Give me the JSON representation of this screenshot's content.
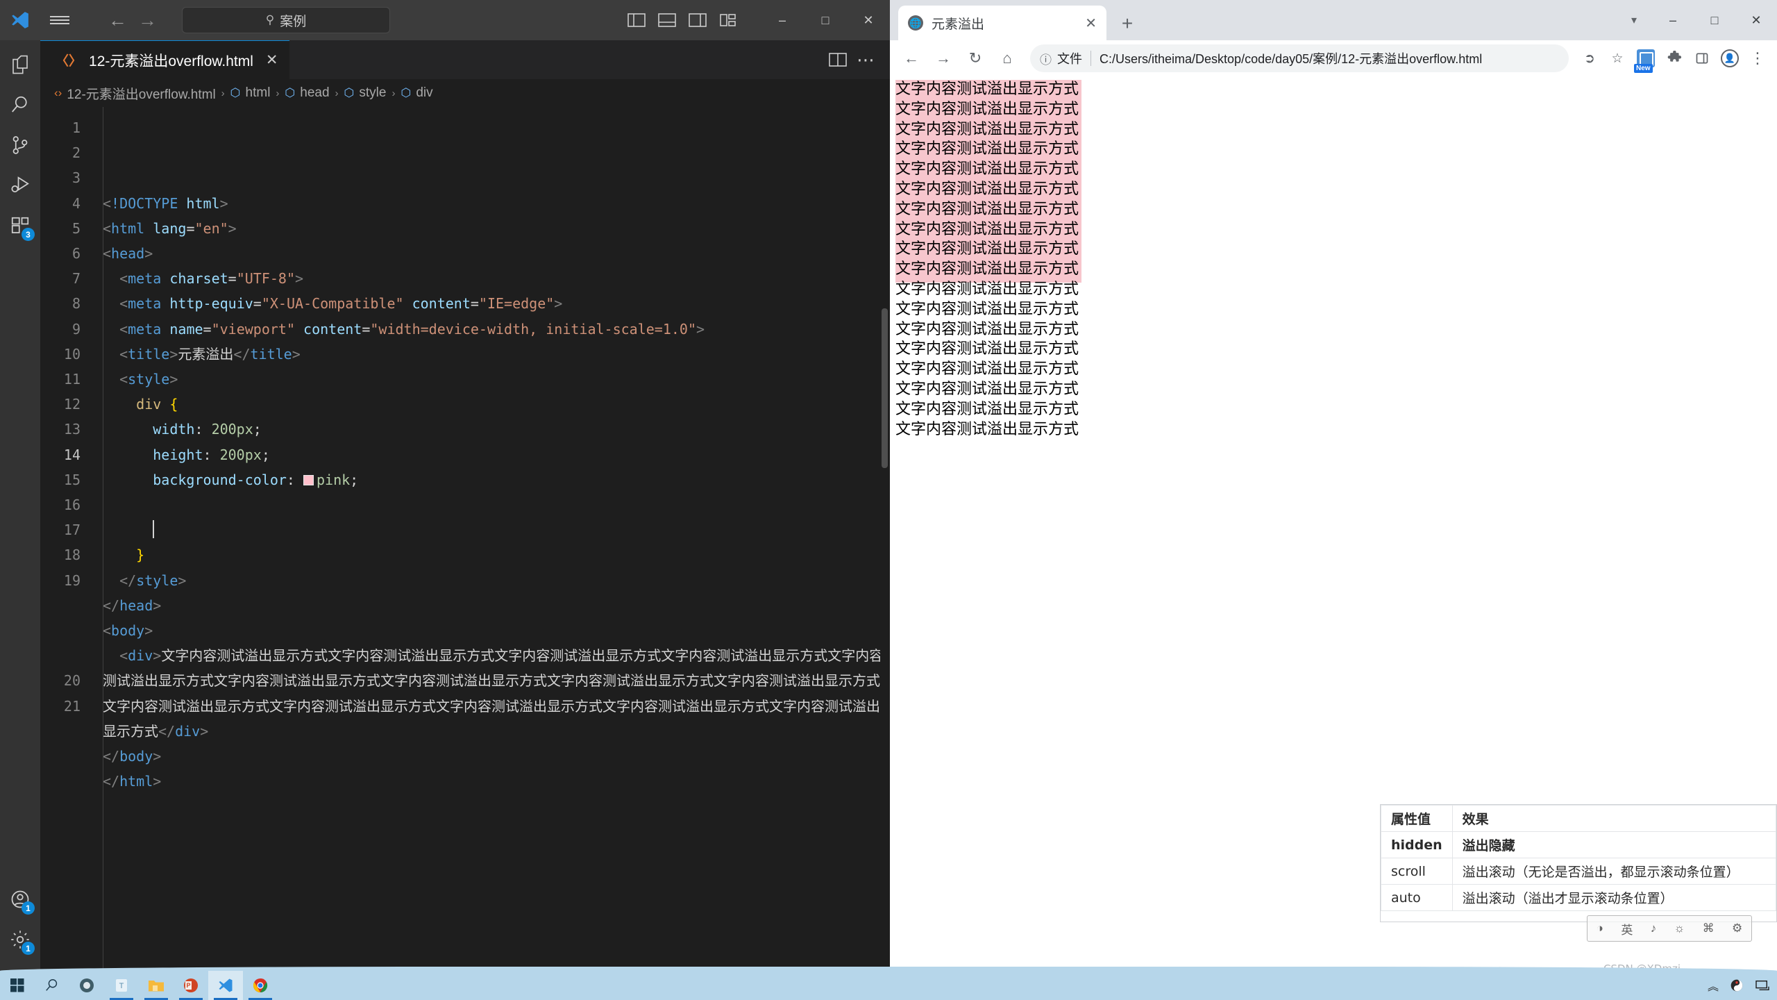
{
  "vscode": {
    "titlebar": {
      "logo_icon": "vscode-logo-icon",
      "menu_icon": "hamburger-menu-icon",
      "back_icon": "back-arrow-icon",
      "forward_icon": "forward-arrow-icon",
      "search_placeholder": "案例",
      "search_icon": "search-icon",
      "layout_icons": [
        "toggle-primary-sidebar-icon",
        "toggle-panel-icon",
        "toggle-secondary-sidebar-icon",
        "customize-layout-icon"
      ],
      "minimize_label": "–",
      "maximize_label": "□",
      "close_label": "✕"
    },
    "activitybar": {
      "items": [
        {
          "name": "explorer",
          "icon": "files-icon",
          "badge": ""
        },
        {
          "name": "search",
          "icon": "search-icon",
          "badge": ""
        },
        {
          "name": "source-control",
          "icon": "source-control-icon",
          "badge": ""
        },
        {
          "name": "run-and-debug",
          "icon": "run-debug-icon",
          "badge": ""
        },
        {
          "name": "extensions",
          "icon": "extensions-icon",
          "badge": "3"
        }
      ],
      "bottom_items": [
        {
          "name": "accounts",
          "icon": "account-icon",
          "badge": "1"
        },
        {
          "name": "settings",
          "icon": "gear-icon",
          "badge": "1"
        }
      ]
    },
    "tab": {
      "icon": "html-file-icon",
      "label": "12-元素溢出overflow.html",
      "close_label": "✕",
      "split_editor_icon": "split-editor-icon",
      "more_actions_icon": "more-actions-icon"
    },
    "breadcrumb": {
      "file_icon": "html-file-icon",
      "items": [
        "12-元素溢出overflow.html",
        "html",
        "head",
        "style",
        "div"
      ],
      "separator": "›",
      "symbol_icon": "symbol-cube-icon",
      "last_icon": "symbol-css-icon"
    },
    "code": {
      "active_line": 14,
      "lines": [
        {
          "n": 1,
          "tokens": [
            {
              "t": "brk",
              "v": "<"
            },
            {
              "t": "tag",
              "v": "!DOCTYPE "
            },
            {
              "t": "attr",
              "v": "html"
            },
            {
              "t": "brk",
              "v": ">"
            }
          ]
        },
        {
          "n": 2,
          "tokens": [
            {
              "t": "brk",
              "v": "<"
            },
            {
              "t": "tag",
              "v": "html "
            },
            {
              "t": "attr",
              "v": "lang"
            },
            {
              "t": "punct",
              "v": "="
            },
            {
              "t": "str",
              "v": "\"en\""
            },
            {
              "t": "brk",
              "v": ">"
            }
          ]
        },
        {
          "n": 3,
          "tokens": [
            {
              "t": "brk",
              "v": "<"
            },
            {
              "t": "tag",
              "v": "head"
            },
            {
              "t": "brk",
              "v": ">"
            }
          ]
        },
        {
          "n": 4,
          "tokens": [
            {
              "t": "txt",
              "v": "  "
            },
            {
              "t": "brk",
              "v": "<"
            },
            {
              "t": "tag",
              "v": "meta "
            },
            {
              "t": "attr",
              "v": "charset"
            },
            {
              "t": "punct",
              "v": "="
            },
            {
              "t": "str",
              "v": "\"UTF-8\""
            },
            {
              "t": "brk",
              "v": ">"
            }
          ]
        },
        {
          "n": 5,
          "tokens": [
            {
              "t": "txt",
              "v": "  "
            },
            {
              "t": "brk",
              "v": "<"
            },
            {
              "t": "tag",
              "v": "meta "
            },
            {
              "t": "attr",
              "v": "http-equiv"
            },
            {
              "t": "punct",
              "v": "="
            },
            {
              "t": "str",
              "v": "\"X-UA-Compatible\""
            },
            {
              "t": "txt",
              "v": " "
            },
            {
              "t": "attr",
              "v": "content"
            },
            {
              "t": "punct",
              "v": "="
            },
            {
              "t": "str",
              "v": "\"IE=edge\""
            },
            {
              "t": "brk",
              "v": ">"
            }
          ]
        },
        {
          "n": 6,
          "tokens": [
            {
              "t": "txt",
              "v": "  "
            },
            {
              "t": "brk",
              "v": "<"
            },
            {
              "t": "tag",
              "v": "meta "
            },
            {
              "t": "attr",
              "v": "name"
            },
            {
              "t": "punct",
              "v": "="
            },
            {
              "t": "str",
              "v": "\"viewport\""
            },
            {
              "t": "txt",
              "v": " "
            },
            {
              "t": "attr",
              "v": "content"
            },
            {
              "t": "punct",
              "v": "="
            },
            {
              "t": "str",
              "v": "\"width=device-width, initial-scale=1.0\""
            },
            {
              "t": "brk",
              "v": ">"
            }
          ]
        },
        {
          "n": 7,
          "tokens": [
            {
              "t": "txt",
              "v": "  "
            },
            {
              "t": "brk",
              "v": "<"
            },
            {
              "t": "tag",
              "v": "title"
            },
            {
              "t": "brk",
              "v": ">"
            },
            {
              "t": "txt",
              "v": "元素溢出"
            },
            {
              "t": "brk",
              "v": "</"
            },
            {
              "t": "tag",
              "v": "title"
            },
            {
              "t": "brk",
              "v": ">"
            }
          ]
        },
        {
          "n": 8,
          "tokens": [
            {
              "t": "txt",
              "v": "  "
            },
            {
              "t": "brk",
              "v": "<"
            },
            {
              "t": "tag",
              "v": "style"
            },
            {
              "t": "brk",
              "v": ">"
            }
          ]
        },
        {
          "n": 9,
          "tokens": [
            {
              "t": "txt",
              "v": "    "
            },
            {
              "t": "sel",
              "v": "div"
            },
            {
              "t": "txt",
              "v": " "
            },
            {
              "t": "brace",
              "v": "{"
            }
          ]
        },
        {
          "n": 10,
          "tokens": [
            {
              "t": "txt",
              "v": "      "
            },
            {
              "t": "prop",
              "v": "width"
            },
            {
              "t": "punct",
              "v": ": "
            },
            {
              "t": "num",
              "v": "200px"
            },
            {
              "t": "punct",
              "v": ";"
            }
          ]
        },
        {
          "n": 11,
          "tokens": [
            {
              "t": "txt",
              "v": "      "
            },
            {
              "t": "prop",
              "v": "height"
            },
            {
              "t": "punct",
              "v": ": "
            },
            {
              "t": "num",
              "v": "200px"
            },
            {
              "t": "punct",
              "v": ";"
            }
          ]
        },
        {
          "n": 12,
          "tokens": [
            {
              "t": "txt",
              "v": "      "
            },
            {
              "t": "prop",
              "v": "background-color"
            },
            {
              "t": "punct",
              "v": ": "
            },
            {
              "t": "swatch",
              "v": "#ffc0cb"
            },
            {
              "t": "num",
              "v": "pink"
            },
            {
              "t": "punct",
              "v": ";"
            }
          ]
        },
        {
          "n": 13,
          "tokens": []
        },
        {
          "n": 14,
          "tokens": [
            {
              "t": "txt",
              "v": "      "
            },
            {
              "t": "cursor",
              "v": ""
            }
          ]
        },
        {
          "n": 15,
          "tokens": [
            {
              "t": "txt",
              "v": "    "
            },
            {
              "t": "brace",
              "v": "}"
            }
          ]
        },
        {
          "n": 16,
          "tokens": [
            {
              "t": "txt",
              "v": "  "
            },
            {
              "t": "brk",
              "v": "</"
            },
            {
              "t": "tag",
              "v": "style"
            },
            {
              "t": "brk",
              "v": ">"
            }
          ]
        },
        {
          "n": 17,
          "tokens": [
            {
              "t": "brk",
              "v": "</"
            },
            {
              "t": "tag",
              "v": "head"
            },
            {
              "t": "brk",
              "v": ">"
            }
          ]
        },
        {
          "n": 18,
          "tokens": [
            {
              "t": "brk",
              "v": "<"
            },
            {
              "t": "tag",
              "v": "body"
            },
            {
              "t": "brk",
              "v": ">"
            }
          ]
        },
        {
          "n": 19,
          "tokens": [
            {
              "t": "txt",
              "v": "  "
            },
            {
              "t": "brk",
              "v": "<"
            },
            {
              "t": "tag",
              "v": "div"
            },
            {
              "t": "brk",
              "v": ">"
            },
            {
              "t": "txt",
              "v": "文字内容测试溢出显示方式文字内容测试溢出显示方式文字内容测试溢出显示方式文字内容测试溢出显示方式文字内容测试溢出显示方式文字内容测试溢出显示方式文字内容测试溢出显示方式文字内容测试溢出显示方式文字内容测试溢出显示方式文字内容测试溢出显示方式文字内容测试溢出显示方式文字内容测试溢出显示方式文字内容测试溢出显示方式文字内容测试溢出显示方式"
            },
            {
              "t": "brk",
              "v": "</"
            },
            {
              "t": "tag",
              "v": "div"
            },
            {
              "t": "brk",
              "v": ">"
            }
          ]
        },
        {
          "n": 20,
          "tokens": [
            {
              "t": "brk",
              "v": "</"
            },
            {
              "t": "tag",
              "v": "body"
            },
            {
              "t": "brk",
              "v": ">"
            }
          ]
        },
        {
          "n": 21,
          "tokens": [
            {
              "t": "brk",
              "v": "</"
            },
            {
              "t": "tag",
              "v": "html"
            },
            {
              "t": "brk",
              "v": ">"
            }
          ]
        }
      ]
    }
  },
  "chrome": {
    "tab": {
      "favicon": "globe-icon",
      "title": "元素溢出",
      "close_label": "✕"
    },
    "newtab_label": "+",
    "window": {
      "caret_icon": "chevron-down-icon",
      "minimize_label": "–",
      "maximize_label": "□",
      "close_label": "✕"
    },
    "toolbar": {
      "back_icon": "back-arrow-icon",
      "forward_icon": "forward-arrow-icon",
      "reload_icon": "reload-icon",
      "home_icon": "home-icon",
      "info_icon": "page-info-icon",
      "scheme_label": "文件",
      "url": "C:/Users/itheima/Desktop/code/day05/案例/12-元素溢出overflow.html",
      "share_icon": "share-icon",
      "bookmark_icon": "star-icon",
      "extension_new_icon": "extension-new-icon",
      "extension_new_badge": "New",
      "extensions_icon": "puzzle-icon",
      "sidepanel_icon": "side-panel-icon",
      "profile_icon": "profile-avatar-icon",
      "menu_icon": "three-dot-menu-icon"
    },
    "page": {
      "line_text": "文字内容测试溢出显示方式",
      "total_lines": 18,
      "pink_lines": 10,
      "pink_color": "#f7c6cd"
    }
  },
  "overlay_table": {
    "headers": [
      "属性值",
      "效果"
    ],
    "rows": [
      {
        "key": "hidden",
        "value": "溢出隐藏",
        "bold": true
      },
      {
        "key": "scroll",
        "value": "溢出滚动（无论是否溢出，都显示滚动条位置）",
        "bold": false
      },
      {
        "key": "auto",
        "value": "溢出滚动（溢出才显示滚动条位置）",
        "bold": false
      }
    ]
  },
  "ime_bar": {
    "icons": [
      "ime-mode-icon",
      "ime-chinese-icon",
      "ime-punctuation-icon",
      "ime-voice-icon",
      "ime-keyboard-icon",
      "ime-settings-icon"
    ]
  },
  "watermark": {
    "text": "CSDN @XDmzj"
  },
  "taskbar": {
    "start_icon": "windows-start-icon",
    "search_icon": "search-icon",
    "items": [
      {
        "name": "cortana",
        "icon": "cortana-icon",
        "running": false
      },
      {
        "name": "teams",
        "icon": "teams-icon",
        "running": true
      },
      {
        "name": "file-explorer",
        "icon": "file-explorer-icon",
        "running": true
      },
      {
        "name": "powerpoint",
        "icon": "powerpoint-icon",
        "running": true
      },
      {
        "name": "vscode",
        "icon": "vscode-icon",
        "running": true
      },
      {
        "name": "chrome",
        "icon": "chrome-icon",
        "running": true
      }
    ],
    "tray": {
      "show_hidden_icon": "chevron-up-icon",
      "ime_icon": "ime-tray-icon",
      "network_icon": "network-icon"
    }
  }
}
